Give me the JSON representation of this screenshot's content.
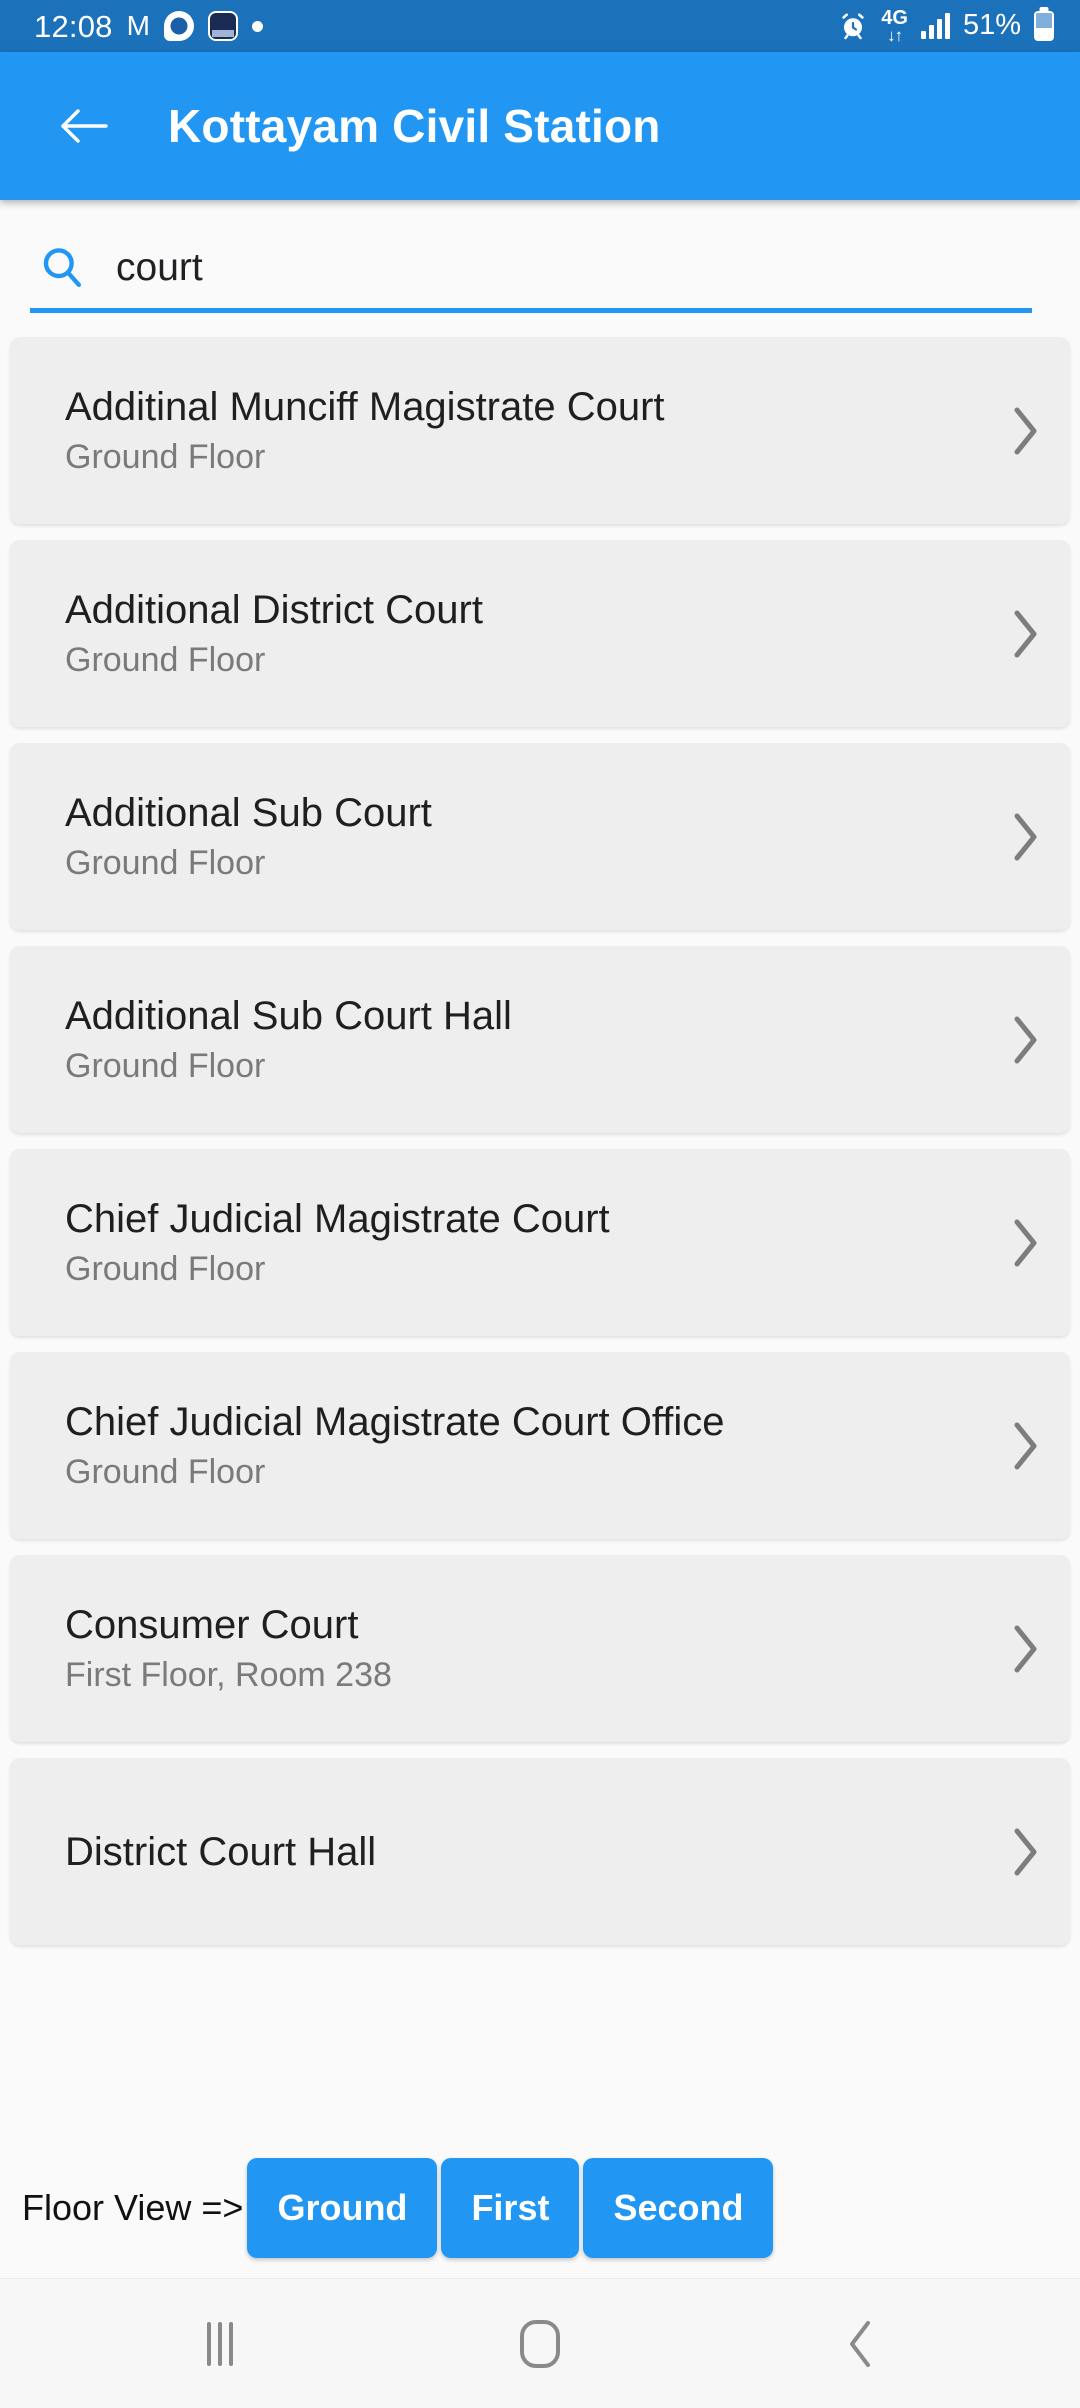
{
  "status_bar": {
    "time": "12:08",
    "left_icons": [
      "gmail-icon",
      "chat-badge-icon",
      "app-tile-icon",
      "dot-indicator-icon"
    ],
    "alarm_icon": "alarm-icon",
    "network_label": "4G",
    "network_arrows": "↓↑",
    "signal_icon": "signal-bars-icon",
    "battery_percent": "51%",
    "battery_icon": "battery-icon",
    "background_color": "#1b72bb"
  },
  "app_bar": {
    "back_icon": "back-arrow-icon",
    "title": "Kottayam Civil Station",
    "background_color": "#2196f3"
  },
  "search": {
    "icon": "search-icon",
    "value": "court",
    "placeholder": "Search",
    "underline_color": "#2196f3"
  },
  "results": [
    {
      "title": "Additinal Munciff Magistrate Court",
      "location": "Ground Floor",
      "chevron": "chevron-right-icon"
    },
    {
      "title": "Additional District Court",
      "location": "Ground Floor",
      "chevron": "chevron-right-icon"
    },
    {
      "title": "Additional Sub Court",
      "location": "Ground Floor",
      "chevron": "chevron-right-icon"
    },
    {
      "title": "Additional Sub Court Hall",
      "location": "Ground Floor",
      "chevron": "chevron-right-icon"
    },
    {
      "title": "Chief Judicial Magistrate Court",
      "location": "Ground Floor",
      "chevron": "chevron-right-icon"
    },
    {
      "title": "Chief Judicial Magistrate Court Office",
      "location": "Ground Floor",
      "chevron": "chevron-right-icon"
    },
    {
      "title": "Consumer Court",
      "location": "First Floor, Room 238",
      "chevron": "chevron-right-icon"
    },
    {
      "title": "District Court Hall",
      "location": "",
      "chevron": "chevron-right-icon"
    }
  ],
  "floor_view": {
    "label": "Floor View =>",
    "buttons": [
      {
        "label": "Ground"
      },
      {
        "label": "First"
      },
      {
        "label": "Second"
      }
    ],
    "button_color": "#2196f3"
  },
  "nav_bar": {
    "recents": "recents-icon",
    "home": "home-icon",
    "back": "back-icon"
  }
}
